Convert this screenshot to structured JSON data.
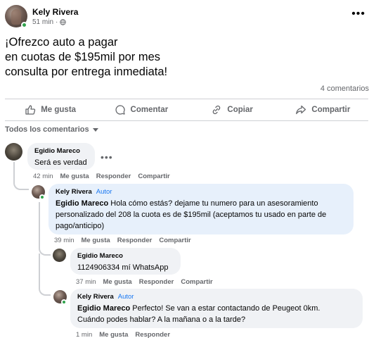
{
  "post": {
    "author": "Kely Rivera",
    "time": "51 min",
    "separator": "·",
    "more": "•••",
    "text_lines": [
      "¡Ofrezco auto a pagar",
      "en cuotas de $195mil por mes",
      "consulta por entrega inmediata!"
    ],
    "comment_count": "4 comentarios"
  },
  "actions": {
    "like": "Me gusta",
    "comment": "Comentar",
    "copy": "Copiar",
    "share": "Compartir"
  },
  "filter_label": "Todos los comentarios",
  "comments": [
    {
      "author": "Egidio Mareco",
      "text": "Será es verdad",
      "time": "42 min",
      "like": "Me gusta",
      "reply": "Responder",
      "share": "Compartir",
      "more": "•••"
    },
    {
      "author": "Kely Rivera",
      "badge": "Autor",
      "mention": "Egidio Mareco",
      "text_lines": [
        "Hola cómo estás? dejame tu numero para un asesoramiento",
        "personalizado del 208 la cuota es de $195mil (aceptamos tu usado en parte de",
        "pago/anticipo)"
      ],
      "time": "39 min",
      "like": "Me gusta",
      "reply": "Responder",
      "share": "Compartir"
    },
    {
      "author": "Egidio Mareco",
      "text": "1124906334 mí WhatsApp",
      "time": "37 min",
      "like": "Me gusta",
      "reply": "Responder",
      "share": "Compartir"
    },
    {
      "author": "Kely Rivera",
      "badge": "Autor",
      "mention": "Egidio Mareco",
      "text_lines": [
        "Perfecto! Se van a estar contactando de Peugeot 0km.",
        "Cuándo podes hablar? A la mañana o a la tarde?"
      ],
      "time": "1 min",
      "like": "Me gusta",
      "reply": "Responder"
    }
  ],
  "colors": {
    "accent": "#1877f2",
    "online": "#31a24c",
    "bubble": "#f0f2f5",
    "bubble_highlight": "#e7f0fb",
    "secondary_text": "#65676b"
  }
}
